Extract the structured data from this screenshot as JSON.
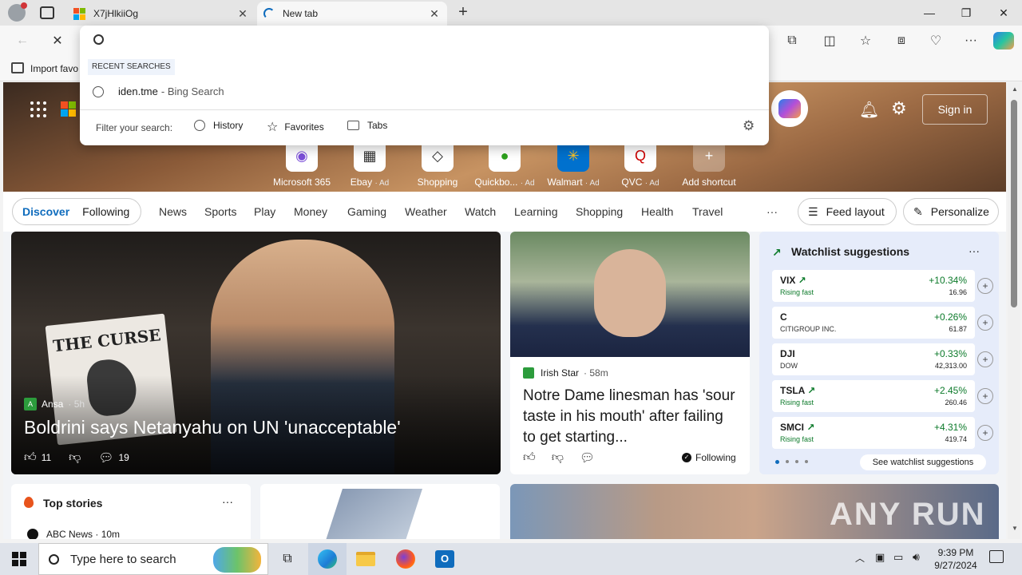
{
  "tabs": [
    {
      "title": "X7jHlkiiOg"
    },
    {
      "title": "New tab"
    }
  ],
  "favorites_bar": {
    "import_label": "Import favo"
  },
  "dropdown": {
    "section_label": "RECENT SEARCHES",
    "recent_query": "iden.tme",
    "recent_source": " - Bing Search",
    "filter_label": "Filter your search:",
    "filters": [
      "History",
      "Favorites",
      "Tabs"
    ]
  },
  "header": {
    "signin_label": "Sign in"
  },
  "shortcuts": [
    {
      "label": "Microsoft 365",
      "ad": ""
    },
    {
      "label": "Ebay",
      "ad": "· Ad"
    },
    {
      "label": "Shopping",
      "ad": ""
    },
    {
      "label": "Quickbo...",
      "ad": "· Ad"
    },
    {
      "label": "Walmart",
      "ad": "· Ad"
    },
    {
      "label": "QVC",
      "ad": "· Ad"
    },
    {
      "label": "Add shortcut",
      "ad": ""
    }
  ],
  "nav": {
    "discover": "Discover",
    "following": "Following",
    "items": [
      "News",
      "Sports",
      "Play",
      "Money",
      "Gaming",
      "Weather",
      "Watch",
      "Learning",
      "Shopping",
      "Health",
      "Travel"
    ],
    "more": "···",
    "feed_layout": "Feed layout",
    "personalize": "Personalize"
  },
  "big_story": {
    "source": "Ansa",
    "age": "· 5h",
    "headline": "Boldrini says Netanyahu on UN 'unacceptable'",
    "likes": "11",
    "comments": "19",
    "sign_text": "THE CURSE"
  },
  "mid_story": {
    "source": "Irish Star",
    "age": "· 58m",
    "headline": "Notre Dame linesman has 'sour taste in his mouth' after failing to get starting...",
    "following": "Following"
  },
  "watchlist": {
    "title": "Watchlist suggestions",
    "more": "···",
    "rows": [
      {
        "sym": "VIX",
        "sub": "Rising fast",
        "pct": "+10.34%",
        "price": "16.96",
        "rising": true
      },
      {
        "sym": "C",
        "sub": "CITIGROUP INC.",
        "pct": "+0.26%",
        "price": "61.87",
        "rising": false
      },
      {
        "sym": "DJI",
        "sub": "DOW",
        "pct": "+0.33%",
        "price": "42,313.00",
        "rising": false
      },
      {
        "sym": "TSLA",
        "sub": "Rising fast",
        "pct": "+2.45%",
        "price": "260.46",
        "rising": true
      },
      {
        "sym": "SMCI",
        "sub": "Rising fast",
        "pct": "+4.31%",
        "price": "419.74",
        "rising": true
      }
    ],
    "see_all": "See watchlist suggestions"
  },
  "top_stories": {
    "title": "Top stories",
    "more": "···",
    "first_source": "ABC News",
    "first_age": "· 10m"
  },
  "watermark": "ANY RUN",
  "taskbar": {
    "search_placeholder": "Type here to search",
    "time": "9:39 PM",
    "date": "9/27/2024"
  },
  "colors": {
    "accent": "#0f6cbd",
    "positive": "#0c7a2a",
    "taskbar": "#dfe3ea"
  }
}
